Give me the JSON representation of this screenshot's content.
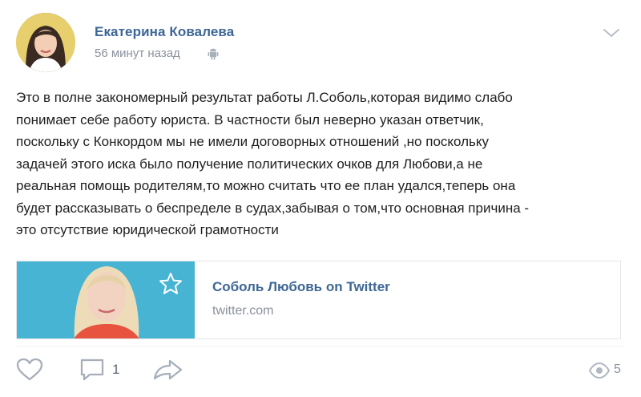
{
  "post": {
    "author": "Екатерина Ковалева",
    "time": "56 минут назад",
    "text": "Это в полне закономерный результат работы Л.Соболь,которая видимо слабо\nпонимает себе работу юриста. В частности был неверно указан ответчик,\nпоскольку с Конкордом мы не имели договорных отношений ,но поскольку\nзадачей этого иска было получение политических очков для Любови,а не\nреальная помощь родителям,то можно считать что ее план удался,теперь она\nбудет рассказывать о беспределе в судах,забывая о том,что основная причина -\nэто отсутствие юридической грамотности",
    "link": {
      "title": "Соболь Любовь on Twitter",
      "domain": "twitter.com"
    },
    "stats": {
      "comments": "1",
      "views": "5"
    },
    "icons": {
      "platform": "android-icon",
      "menu": "chevron-down-icon",
      "like": "heart-icon",
      "comment": "comment-icon",
      "share": "share-arrow-icon",
      "views": "eye-icon",
      "favorite": "star-icon"
    },
    "colors": {
      "accent": "#3e6795",
      "muted": "#8a929c",
      "card_thumb_bg": "#47b4d3"
    }
  }
}
